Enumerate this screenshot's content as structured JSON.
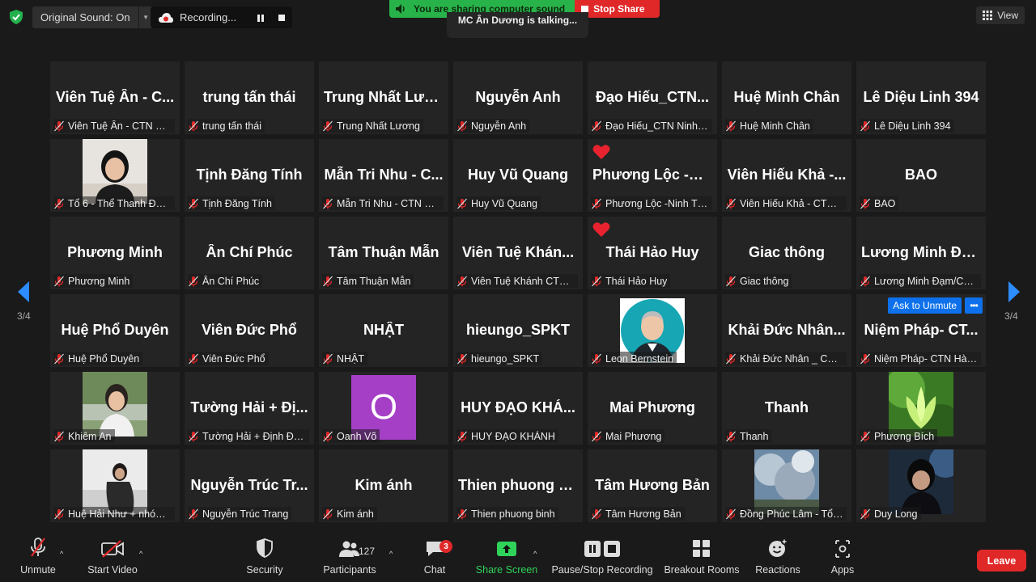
{
  "top": {
    "original_sound": "Original Sound: On",
    "recording": "Recording...",
    "sharing_banner": "You are sharing computer sound",
    "stop_share": "Stop Share",
    "talking": "MC Ân Dương is talking...",
    "view": "View"
  },
  "paging": {
    "left": "3/4",
    "right": "3/4"
  },
  "tiles": [
    {
      "big": "Viên Tuệ Ân - C...",
      "name": "Viên Tuệ Ân - CTN Đài..."
    },
    {
      "big": "trung tấn thái",
      "name": "trung tấn thái"
    },
    {
      "big": "Trung Nhất Lươ...",
      "name": "Trung Nhất Lương"
    },
    {
      "big": "Nguyễn Anh",
      "name": "Nguyễn Anh"
    },
    {
      "big": "Đạo Hiếu_CTN...",
      "name": "Đạo Hiếu_CTN Ninh T..."
    },
    {
      "big": "Huệ Minh Chân",
      "name": "Huệ Minh Chân"
    },
    {
      "big": "Lê Diệu Linh 394",
      "name": "Lê Diệu Linh 394"
    },
    {
      "big": "",
      "name": "Tổ 6 - Thể Thanh Đạm...",
      "photo": "girl"
    },
    {
      "big": "Tịnh Đăng Tính",
      "name": "Tịnh Đăng Tính"
    },
    {
      "big": "Mẫn Tri Nhu - C...",
      "name": "Mẫn Tri Nhu - CTN HC..."
    },
    {
      "big": "Huy Vũ Quang",
      "name": "Huy Vũ Quang"
    },
    {
      "big": "Phương Lộc -Ni...",
      "name": "Phương Lộc -Ninh Thu...",
      "heart": true
    },
    {
      "big": "Viên Hiếu Khả -...",
      "name": "Viên Hiếu Khả - CTN H..."
    },
    {
      "big": "BAO",
      "name": "BAO"
    },
    {
      "big": "Phương Minh",
      "name": "Phương Minh"
    },
    {
      "big": "Ân Chí Phúc",
      "name": "Ân Chí Phúc"
    },
    {
      "big": "Tâm Thuận Mẫn",
      "name": "Tâm Thuận Mẫn"
    },
    {
      "big": "Viên Tuệ Khán...",
      "name": "Viên Tuệ Khánh CTN ..."
    },
    {
      "big": "Thái Hảo Huy",
      "name": "Thái Hảo Huy",
      "heart": true
    },
    {
      "big": "Giac thông",
      "name": "Giac thông"
    },
    {
      "big": "Lương Minh Đạ...",
      "name": "Lương Minh Đạm/CTN..."
    },
    {
      "big": "Huệ Phổ Duyên",
      "name": "Huệ Phổ Duyên"
    },
    {
      "big": "Viên Đức Phổ",
      "name": "Viên Đức Phổ"
    },
    {
      "big": "NHẬT",
      "name": "NHẬT"
    },
    {
      "big": "hieungo_SPKT",
      "name": "hieungo_SPKT"
    },
    {
      "big": "",
      "name": "Leon Bernstein",
      "photo": "leon"
    },
    {
      "big": "Khải Đức Nhân...",
      "name": "Khải Đức Nhân _ CNT ..."
    },
    {
      "big": "Niệm Pháp- CT...",
      "name": "Niệm Pháp- CTN Hàn ...",
      "ask": "Ask to Unmute"
    },
    {
      "big": "",
      "name": "Khiêm An",
      "photo": "khiem"
    },
    {
      "big": "Tường Hải + Đị...",
      "name": "Tường Hải + Định Đạo..."
    },
    {
      "big": "",
      "name": "Oanh Võ",
      "avatar": "O"
    },
    {
      "big": "HUY ĐẠO KHÁ...",
      "name": "HUY ĐẠO KHÁNH"
    },
    {
      "big": "Mai Phương",
      "name": "Mai Phương"
    },
    {
      "big": "Thanh",
      "name": "Thanh"
    },
    {
      "big": "",
      "name": "Phương Bích",
      "photo": "lotus"
    },
    {
      "big": "",
      "name": "Huệ Hải Như + nhóm ...",
      "photo": "hue"
    },
    {
      "big": "Nguyễn Trúc Tr...",
      "name": "Nguyễn Trúc Trang"
    },
    {
      "big": "Kim ánh",
      "name": "Kim ánh"
    },
    {
      "big": "Thien phuong b...",
      "name": "Thien phuong binh"
    },
    {
      "big": "Tâm Hương Bản",
      "name": "Tâm Hương Bản"
    },
    {
      "big": "",
      "name": "Đồng Phúc Lâm - Tổ 8...",
      "photo": "sky"
    },
    {
      "big": "",
      "name": "Duy Long",
      "photo": "duy"
    }
  ],
  "toolbar": {
    "unmute": "Unmute",
    "start_video": "Start Video",
    "security": "Security",
    "participants": "Participants",
    "participants_count": "127",
    "chat": "Chat",
    "chat_badge": "3",
    "share_screen": "Share Screen",
    "pause_stop": "Pause/Stop Recording",
    "breakout": "Breakout Rooms",
    "reactions": "Reactions",
    "apps": "Apps",
    "leave": "Leave"
  },
  "colors": {
    "accent_blue": "#0e71eb",
    "red": "#e02828",
    "green": "#28b34a"
  }
}
